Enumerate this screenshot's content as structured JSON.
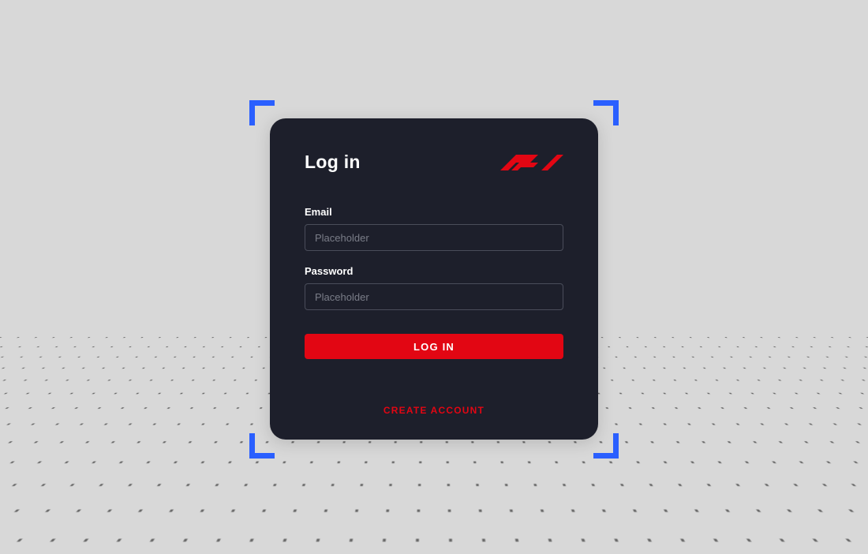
{
  "card": {
    "title": "Log in",
    "logo_name": "f1-logo"
  },
  "form": {
    "email": {
      "label": "Email",
      "placeholder": "Placeholder",
      "value": ""
    },
    "password": {
      "label": "Password",
      "placeholder": "Placeholder",
      "value": ""
    },
    "submit_label": "LOG IN",
    "create_account_label": "CREATE ACCOUNT"
  },
  "colors": {
    "accent": "#e20613",
    "frame": "#2a5fff",
    "card_bg": "#1d1f2b"
  }
}
